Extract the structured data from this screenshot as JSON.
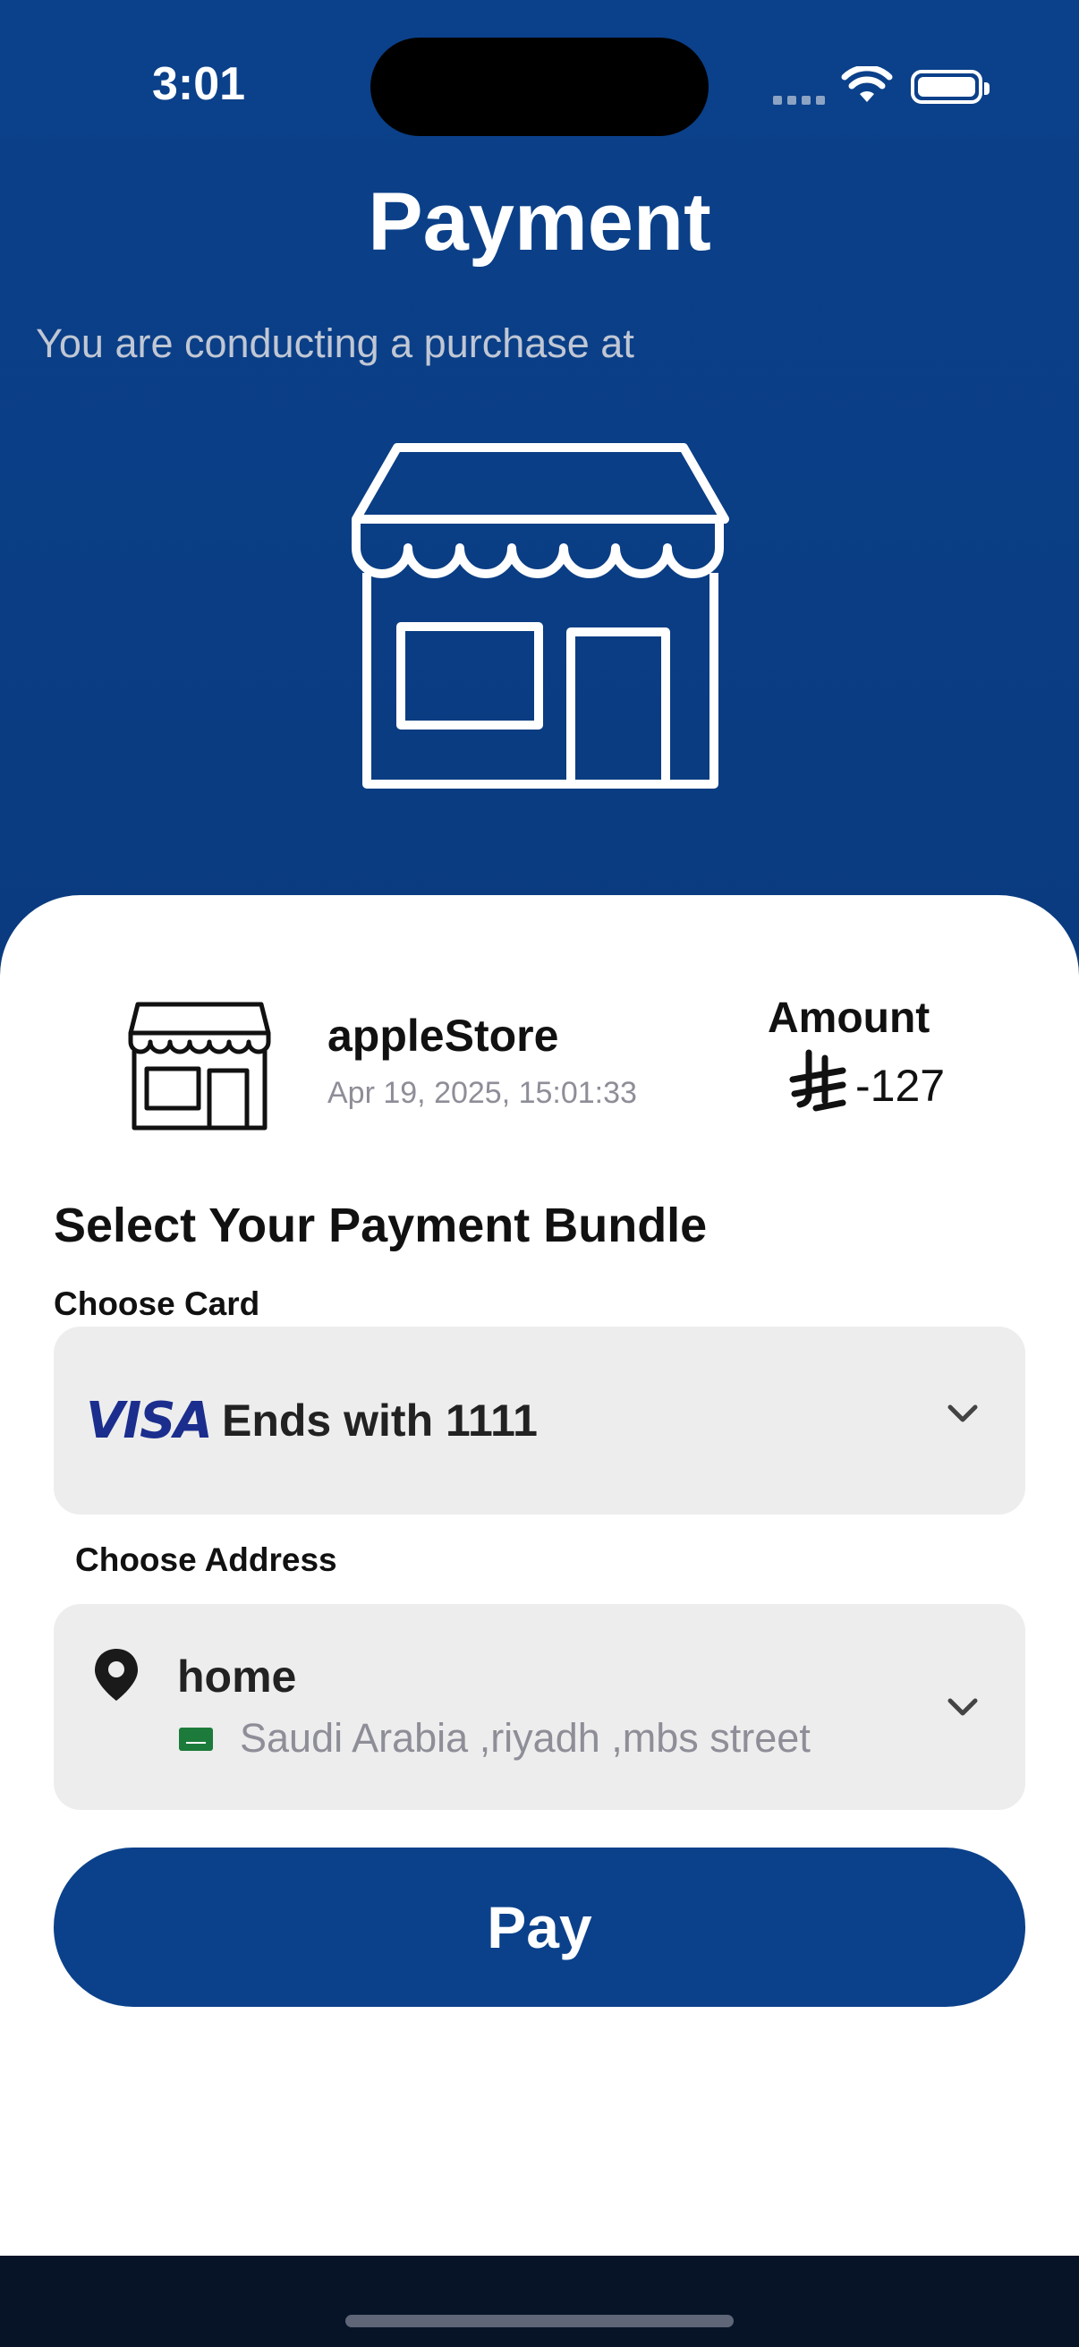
{
  "status_bar": {
    "time": "3:01"
  },
  "header": {
    "title": "Payment",
    "subtitle": "You are conducting a purchase at"
  },
  "merchant": {
    "icon": "storefront-icon",
    "name": "appleStore",
    "datetime": "Apr 19, 2025, 15:01:33",
    "amount_label": "Amount",
    "currency_symbol": "⃁",
    "amount_value": "-127"
  },
  "payment": {
    "section_title": "Select Your Payment Bundle",
    "card_label": "Choose Card",
    "card_brand": "VISA",
    "card_text": "Ends with 1111",
    "address_label": "Choose Address",
    "address_title": "home",
    "address_text": "Saudi Arabia ,riyadh ,mbs street"
  },
  "actions": {
    "pay_label": "Pay"
  },
  "colors": {
    "primary": "#0b418b",
    "sheet": "#ffffff",
    "field": "#ededed",
    "muted_text": "#8e8e98",
    "visa_blue": "#1b2e8e"
  }
}
